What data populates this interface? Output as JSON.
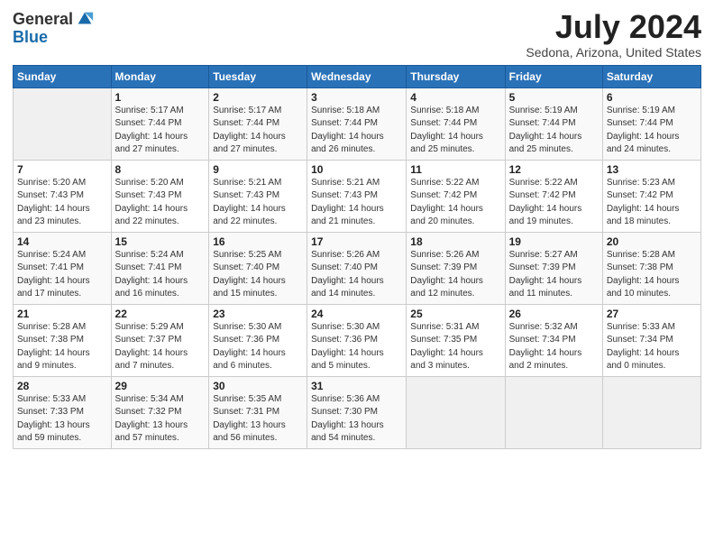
{
  "header": {
    "logo_general": "General",
    "logo_blue": "Blue",
    "month_title": "July 2024",
    "location": "Sedona, Arizona, United States"
  },
  "weekdays": [
    "Sunday",
    "Monday",
    "Tuesday",
    "Wednesday",
    "Thursday",
    "Friday",
    "Saturday"
  ],
  "weeks": [
    [
      {
        "day": "",
        "info": ""
      },
      {
        "day": "1",
        "info": "Sunrise: 5:17 AM\nSunset: 7:44 PM\nDaylight: 14 hours\nand 27 minutes."
      },
      {
        "day": "2",
        "info": "Sunrise: 5:17 AM\nSunset: 7:44 PM\nDaylight: 14 hours\nand 27 minutes."
      },
      {
        "day": "3",
        "info": "Sunrise: 5:18 AM\nSunset: 7:44 PM\nDaylight: 14 hours\nand 26 minutes."
      },
      {
        "day": "4",
        "info": "Sunrise: 5:18 AM\nSunset: 7:44 PM\nDaylight: 14 hours\nand 25 minutes."
      },
      {
        "day": "5",
        "info": "Sunrise: 5:19 AM\nSunset: 7:44 PM\nDaylight: 14 hours\nand 25 minutes."
      },
      {
        "day": "6",
        "info": "Sunrise: 5:19 AM\nSunset: 7:44 PM\nDaylight: 14 hours\nand 24 minutes."
      }
    ],
    [
      {
        "day": "7",
        "info": "Sunrise: 5:20 AM\nSunset: 7:43 PM\nDaylight: 14 hours\nand 23 minutes."
      },
      {
        "day": "8",
        "info": "Sunrise: 5:20 AM\nSunset: 7:43 PM\nDaylight: 14 hours\nand 22 minutes."
      },
      {
        "day": "9",
        "info": "Sunrise: 5:21 AM\nSunset: 7:43 PM\nDaylight: 14 hours\nand 22 minutes."
      },
      {
        "day": "10",
        "info": "Sunrise: 5:21 AM\nSunset: 7:43 PM\nDaylight: 14 hours\nand 21 minutes."
      },
      {
        "day": "11",
        "info": "Sunrise: 5:22 AM\nSunset: 7:42 PM\nDaylight: 14 hours\nand 20 minutes."
      },
      {
        "day": "12",
        "info": "Sunrise: 5:22 AM\nSunset: 7:42 PM\nDaylight: 14 hours\nand 19 minutes."
      },
      {
        "day": "13",
        "info": "Sunrise: 5:23 AM\nSunset: 7:42 PM\nDaylight: 14 hours\nand 18 minutes."
      }
    ],
    [
      {
        "day": "14",
        "info": "Sunrise: 5:24 AM\nSunset: 7:41 PM\nDaylight: 14 hours\nand 17 minutes."
      },
      {
        "day": "15",
        "info": "Sunrise: 5:24 AM\nSunset: 7:41 PM\nDaylight: 14 hours\nand 16 minutes."
      },
      {
        "day": "16",
        "info": "Sunrise: 5:25 AM\nSunset: 7:40 PM\nDaylight: 14 hours\nand 15 minutes."
      },
      {
        "day": "17",
        "info": "Sunrise: 5:26 AM\nSunset: 7:40 PM\nDaylight: 14 hours\nand 14 minutes."
      },
      {
        "day": "18",
        "info": "Sunrise: 5:26 AM\nSunset: 7:39 PM\nDaylight: 14 hours\nand 12 minutes."
      },
      {
        "day": "19",
        "info": "Sunrise: 5:27 AM\nSunset: 7:39 PM\nDaylight: 14 hours\nand 11 minutes."
      },
      {
        "day": "20",
        "info": "Sunrise: 5:28 AM\nSunset: 7:38 PM\nDaylight: 14 hours\nand 10 minutes."
      }
    ],
    [
      {
        "day": "21",
        "info": "Sunrise: 5:28 AM\nSunset: 7:38 PM\nDaylight: 14 hours\nand 9 minutes."
      },
      {
        "day": "22",
        "info": "Sunrise: 5:29 AM\nSunset: 7:37 PM\nDaylight: 14 hours\nand 7 minutes."
      },
      {
        "day": "23",
        "info": "Sunrise: 5:30 AM\nSunset: 7:36 PM\nDaylight: 14 hours\nand 6 minutes."
      },
      {
        "day": "24",
        "info": "Sunrise: 5:30 AM\nSunset: 7:36 PM\nDaylight: 14 hours\nand 5 minutes."
      },
      {
        "day": "25",
        "info": "Sunrise: 5:31 AM\nSunset: 7:35 PM\nDaylight: 14 hours\nand 3 minutes."
      },
      {
        "day": "26",
        "info": "Sunrise: 5:32 AM\nSunset: 7:34 PM\nDaylight: 14 hours\nand 2 minutes."
      },
      {
        "day": "27",
        "info": "Sunrise: 5:33 AM\nSunset: 7:34 PM\nDaylight: 14 hours\nand 0 minutes."
      }
    ],
    [
      {
        "day": "28",
        "info": "Sunrise: 5:33 AM\nSunset: 7:33 PM\nDaylight: 13 hours\nand 59 minutes."
      },
      {
        "day": "29",
        "info": "Sunrise: 5:34 AM\nSunset: 7:32 PM\nDaylight: 13 hours\nand 57 minutes."
      },
      {
        "day": "30",
        "info": "Sunrise: 5:35 AM\nSunset: 7:31 PM\nDaylight: 13 hours\nand 56 minutes."
      },
      {
        "day": "31",
        "info": "Sunrise: 5:36 AM\nSunset: 7:30 PM\nDaylight: 13 hours\nand 54 minutes."
      },
      {
        "day": "",
        "info": ""
      },
      {
        "day": "",
        "info": ""
      },
      {
        "day": "",
        "info": ""
      }
    ]
  ]
}
